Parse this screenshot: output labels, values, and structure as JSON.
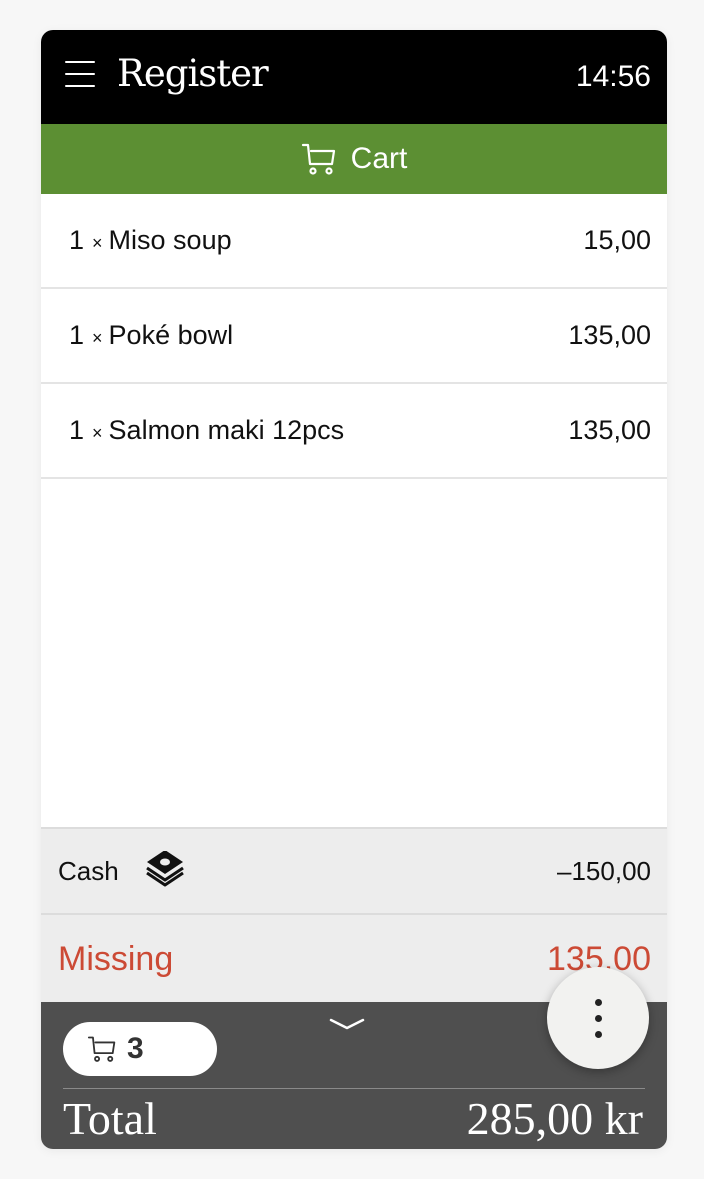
{
  "header": {
    "title": "Register",
    "time": "14:56"
  },
  "cart_bar": {
    "label": "Cart"
  },
  "items": [
    {
      "qty": "1",
      "x": "×",
      "name": "Miso soup",
      "price": "15,00"
    },
    {
      "qty": "1",
      "x": "×",
      "name": "Poké bowl",
      "price": "135,00"
    },
    {
      "qty": "1",
      "x": "×",
      "name": "Salmon maki 12pcs",
      "price": "135,00"
    }
  ],
  "payment": {
    "method": "Cash",
    "icon": "cash-icon",
    "amount": "–150,00"
  },
  "missing": {
    "label": "Missing",
    "amount": "135,00"
  },
  "footer": {
    "cart_count": "3",
    "total_label": "Total",
    "total_value": "285,00 kr"
  },
  "colors": {
    "accent_green": "#5c8f33",
    "missing_red": "#cc4a35",
    "header_black": "#000000",
    "footer_grey": "#4f4f4f"
  }
}
